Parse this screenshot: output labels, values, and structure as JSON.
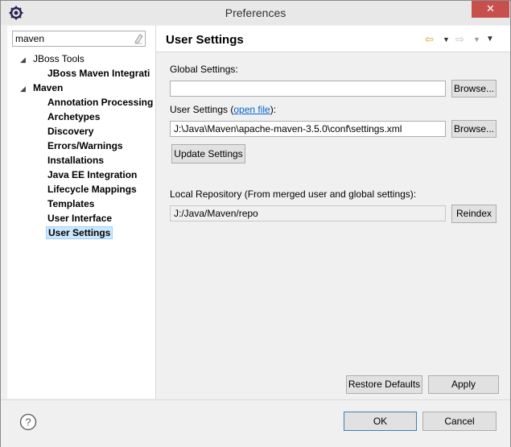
{
  "window": {
    "title": "Preferences",
    "close_glyph": "✕",
    "app_icon": "eclipse-gear-icon",
    "colors": {
      "close_button": "#c7504c",
      "selection": "#cce8ff",
      "link": "#0066cc",
      "back_arrow": "#d8a014"
    }
  },
  "filter": {
    "value": "maven",
    "clear_icon": "eraser-icon"
  },
  "tree": {
    "items": [
      {
        "label": "JBoss Tools",
        "level": 0,
        "expanded": true,
        "bold": false
      },
      {
        "label": "JBoss Maven Integrati",
        "level": 1,
        "bold": true
      },
      {
        "label": "Maven",
        "level": 0,
        "expanded": true,
        "bold": true
      },
      {
        "label": "Annotation Processing",
        "level": 1,
        "bold": true
      },
      {
        "label": "Archetypes",
        "level": 1,
        "bold": true
      },
      {
        "label": "Discovery",
        "level": 1,
        "bold": true
      },
      {
        "label": "Errors/Warnings",
        "level": 1,
        "bold": true
      },
      {
        "label": "Installations",
        "level": 1,
        "bold": true
      },
      {
        "label": "Java EE Integration",
        "level": 1,
        "bold": true
      },
      {
        "label": "Lifecycle Mappings",
        "level": 1,
        "bold": true
      },
      {
        "label": "Templates",
        "level": 1,
        "bold": true
      },
      {
        "label": "User Interface",
        "level": 1,
        "bold": true
      },
      {
        "label": "User Settings",
        "level": 1,
        "bold": true,
        "selected": true
      }
    ],
    "scroll_left": "<",
    "scroll_right": ">"
  },
  "page": {
    "title": "User Settings",
    "nav": {
      "back": "⇦",
      "fwd": "⇨",
      "drop": "▼",
      "menu": "▼"
    },
    "global_settings": {
      "label": "Global Settings:",
      "value": "",
      "browse": "Browse..."
    },
    "user_settings": {
      "label_prefix": "User Settings (",
      "link": "open file",
      "label_suffix": "):",
      "value": "J:\\Java\\Maven\\apache-maven-3.5.0\\conf\\settings.xml",
      "browse": "Browse..."
    },
    "update_button": "Update Settings",
    "local_repo": {
      "label": "Local Repository (From merged user and global settings):",
      "value": "J:/Java/Maven/repo",
      "reindex": "Reindex"
    },
    "restore_defaults": "Restore Defaults",
    "apply": "Apply"
  },
  "footer": {
    "help_icon": "help-icon",
    "ok": "OK",
    "cancel": "Cancel"
  }
}
